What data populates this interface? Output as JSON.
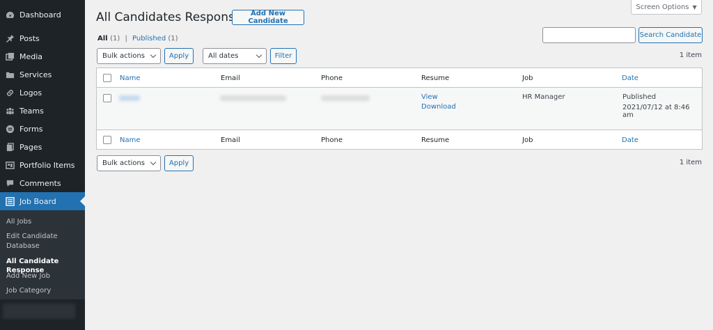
{
  "sidebar": {
    "items": [
      {
        "label": "Dashboard",
        "icon": "dashboard-icon"
      },
      {
        "label": "Posts",
        "icon": "pin-icon"
      },
      {
        "label": "Media",
        "icon": "media-icon"
      },
      {
        "label": "Services",
        "icon": "folder-icon"
      },
      {
        "label": "Logos",
        "icon": "link-icon"
      },
      {
        "label": "Teams",
        "icon": "groups-icon"
      },
      {
        "label": "Forms",
        "icon": "forms-icon"
      },
      {
        "label": "Pages",
        "icon": "pages-icon"
      },
      {
        "label": "Portfolio Items",
        "icon": "portfolio-icon"
      },
      {
        "label": "Comments",
        "icon": "comment-icon"
      },
      {
        "label": "Job Board",
        "icon": "list-icon"
      }
    ],
    "submenu": [
      "All Jobs",
      "Edit Candidate",
      "Database",
      "All Candidate Response",
      "Add New Job",
      "Job Category"
    ]
  },
  "header": {
    "screen_options": "Screen Options",
    "title": "All Candidates Response",
    "add_new": "Add New Candidate"
  },
  "filters": {
    "all_label": "All",
    "all_count": "(1)",
    "separator": "|",
    "published_label": "Published",
    "published_count": "(1)",
    "search_button": "Search Candidate",
    "bulk_actions": "Bulk actions",
    "apply": "Apply",
    "dates": "All dates",
    "filter": "Filter",
    "item_count": "1 item"
  },
  "table": {
    "columns": [
      "Name",
      "Email",
      "Phone",
      "Resume",
      "Job",
      "Date"
    ],
    "row": {
      "resume_view": "View",
      "resume_download": "Download",
      "job": "HR Manager",
      "status": "Published",
      "date": "2021/07/12 at 8:46 am"
    }
  },
  "colors": {
    "sidebar_bg": "#1d2327",
    "accent": "#2271b1",
    "page_bg": "#f0f0f1"
  }
}
